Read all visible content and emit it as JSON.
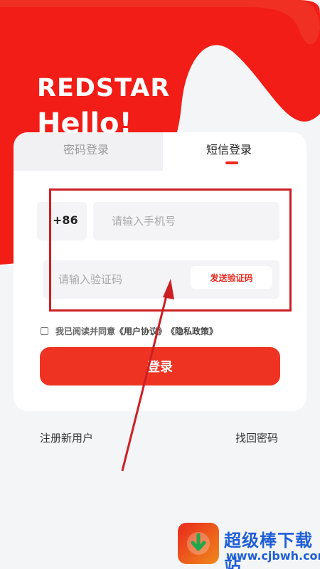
{
  "brand": {
    "logo_text": "REDSTAR",
    "greeting": "Hello!"
  },
  "tabs": [
    {
      "label": "密码登录",
      "active": false
    },
    {
      "label": "短信登录",
      "active": true
    }
  ],
  "form": {
    "country_code": "+86",
    "phone_placeholder": "请输入手机号",
    "phone_value": "",
    "sms_placeholder": "请输入验证码",
    "sms_value": "",
    "send_code_label": "发送验证码"
  },
  "agreement": {
    "checked": false,
    "text": "我已阅读并同意",
    "user_agreement": "《用户协议》",
    "privacy_policy": "《隐私政策》"
  },
  "login_label": "登录",
  "footer": {
    "register": "注册新用户",
    "forgot": "找回密码"
  },
  "watermark": {
    "title": "超级棒下载站",
    "url": "www.cjbwh.com"
  },
  "colors": {
    "accent": "#ee3322",
    "annotation": "#cc1f24",
    "watermark": "#1f5fd6"
  }
}
